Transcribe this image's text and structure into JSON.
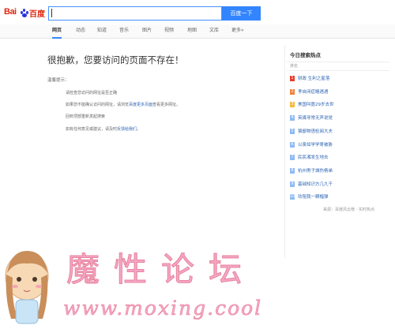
{
  "header": {
    "logo_text": "Bai百度",
    "search_value": "",
    "search_button": "百度一下"
  },
  "tabs": [
    {
      "label": "网页",
      "active": true
    },
    {
      "label": "动态",
      "active": false
    },
    {
      "label": "知道",
      "active": false
    },
    {
      "label": "音乐",
      "active": false
    },
    {
      "label": "图片",
      "active": false
    },
    {
      "label": "视频",
      "active": false
    },
    {
      "label": "地图",
      "active": false
    },
    {
      "label": "文库",
      "active": false
    },
    {
      "label": "更多»",
      "active": false
    }
  ],
  "main": {
    "title": "很抱歉，您要访问的页面不存在！",
    "hint_label": "温馨提示：",
    "hints": [
      {
        "before": "请检查您访问的网址是否正确",
        "link": "",
        "after": ""
      },
      {
        "before": "如果您不能确认访问的网址，请浏览",
        "link": "百度更多页面",
        "after": "查看更多网址。"
      },
      {
        "before": "回到顶部重新发起搜索",
        "link": "",
        "after": ""
      },
      {
        "before": "如有任何意见或建议，请及时",
        "link": "反馈给我们",
        "after": "。"
      }
    ]
  },
  "hot": {
    "title": "今日搜索热点",
    "header": "排名",
    "items": [
      {
        "rank": "1",
        "text": "财政 生利之星落",
        "color": "#e73d2c"
      },
      {
        "rank": "2",
        "text": "孝自闭症略遇遇",
        "color": "#f2803a"
      },
      {
        "rank": "3",
        "text": "美国叫嚣29岁去世",
        "color": "#f7b83d"
      },
      {
        "rank": "4",
        "text": "英媒寻常无声说觉",
        "color": "#8eb9f5"
      },
      {
        "rank": "5",
        "text": "猥鄙物语检阅大夫",
        "color": "#8eb9f5"
      },
      {
        "rank": "6",
        "text": "以泉如学学哥被胁",
        "color": "#8eb9f5"
      },
      {
        "rank": "7",
        "text": "民民湘发生地去",
        "color": "#8eb9f5"
      },
      {
        "rank": "8",
        "text": "杭州男子城伤杨弟",
        "color": "#8eb9f5"
      },
      {
        "rank": "9",
        "text": "基础知识方几九千",
        "color": "#8eb9f5"
      },
      {
        "rank": "10",
        "text": "劝阻我一颗榴弹",
        "color": "#8eb9f5"
      }
    ],
    "source": "来源：百度风云榜 - 实时热点"
  },
  "watermark": {
    "title": "魔性论坛",
    "url": "www.moxing.cool"
  }
}
